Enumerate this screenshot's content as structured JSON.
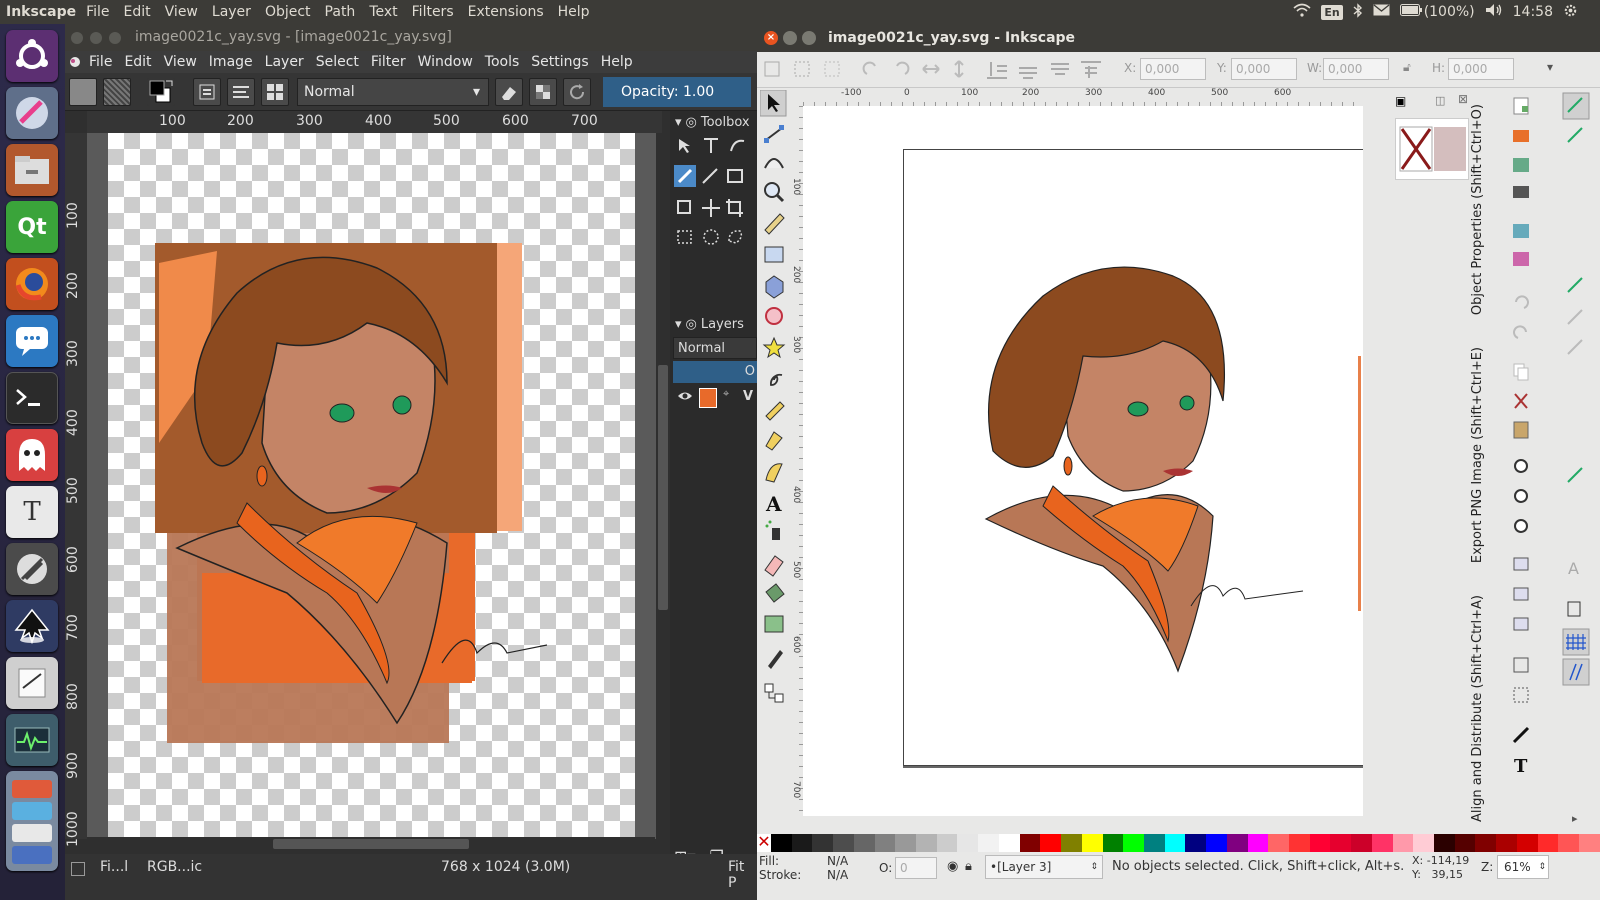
{
  "top_panel": {
    "app_name": "Inkscape",
    "menus": [
      "File",
      "Edit",
      "View",
      "Layer",
      "Object",
      "Path",
      "Text",
      "Filters",
      "Extensions",
      "Help"
    ],
    "keyboard": "En",
    "battery": "(100%)",
    "time": "14:58"
  },
  "launcher": {
    "apps": [
      "ubuntu-dash",
      "image-viewer",
      "file-manager",
      "qt-creator",
      "firefox",
      "messaging",
      "terminal",
      "ghost-app",
      "text-editor",
      "pen-app",
      "inkscape",
      "notes",
      "system-monitor",
      "stacked-apps"
    ]
  },
  "krita": {
    "title": "image0021c_yay.svg  - [image0021c_yay.svg]",
    "menus": [
      "File",
      "Edit",
      "View",
      "Image",
      "Layer",
      "Select",
      "Filter",
      "Window",
      "Tools",
      "Settings",
      "Help"
    ],
    "blend_mode": "Normal",
    "opacity_label": "Opacity:  1.00",
    "ruler_h": [
      "100",
      "200",
      "300",
      "400",
      "500",
      "600",
      "700"
    ],
    "ruler_v": [
      "100",
      "200",
      "300",
      "400",
      "500",
      "600",
      "700",
      "800",
      "900",
      "1000"
    ],
    "toolbox_title": "Toolbox",
    "layers_title": "Layers",
    "layers_blend": "Normal",
    "layers_opacity": "O",
    "layer_name": "V",
    "status_file": "Fi...l",
    "status_color": "RGB...ic",
    "status_size": "768 x 1024 (3.0M)",
    "status_fit": "Fit P"
  },
  "inkscape": {
    "title": "image0021c_yay.svg - Inkscape",
    "x_label": "X:",
    "x_value": "0,000",
    "y_label": "Y:",
    "y_value": "0,000",
    "w_label": "W:",
    "w_value": "0,000",
    "h_label": "H:",
    "h_value": "0,000",
    "ruler_h": [
      "-100",
      "0",
      "100",
      "200",
      "300",
      "400",
      "500",
      "600"
    ],
    "ruler_v": [
      "100",
      "200",
      "300",
      "400",
      "500",
      "600",
      "700"
    ],
    "dock_tabs": [
      "Object Properties (Shift+Ctrl+O)",
      "Export PNG Image (Shift+Ctrl+E)",
      "Align and Distribute (Shift+Ctrl+A)"
    ],
    "fill_label": "Fill:",
    "fill_value": "N/A",
    "stroke_label": "Stroke:",
    "stroke_value": "N/A",
    "opacity_label": "O:",
    "opacity_value": "0",
    "layer": "•[Layer 3]",
    "status_message": "No objects selected. Click, Shift+click, Alt+s.",
    "cursor_x": "X: -114,19",
    "cursor_y": "Y:   39,15",
    "zoom_label": "Z:",
    "zoom_value": "61%",
    "palette": [
      "#000000",
      "#1a1a1a",
      "#333333",
      "#4d4d4d",
      "#666666",
      "#808080",
      "#999999",
      "#b3b3b3",
      "#cccccc",
      "#e6e6e6",
      "#f2f2f2",
      "#ffffff",
      "#800000",
      "#ff0000",
      "#808000",
      "#ffff00",
      "#008000",
      "#00ff00",
      "#008080",
      "#00ffff",
      "#000080",
      "#0000ff",
      "#800080",
      "#ff00ff",
      "#ff6666",
      "#ff3333",
      "#ff0033",
      "#e6002e",
      "#cc0029",
      "#ff3366",
      "#ff99aa",
      "#ffccd5",
      "#2b0000",
      "#550000",
      "#800000",
      "#aa0000",
      "#d40000",
      "#ff2a2a",
      "#ff5555",
      "#ff8080"
    ]
  },
  "colors": {
    "hair": "#8c4a1f",
    "skin": "#c48466",
    "scarf": "#e8641e",
    "bg_orange": "#e86a2a",
    "bg_peach": "#f5a678",
    "coat": "#b87756",
    "eye": "#1f9a5a"
  }
}
